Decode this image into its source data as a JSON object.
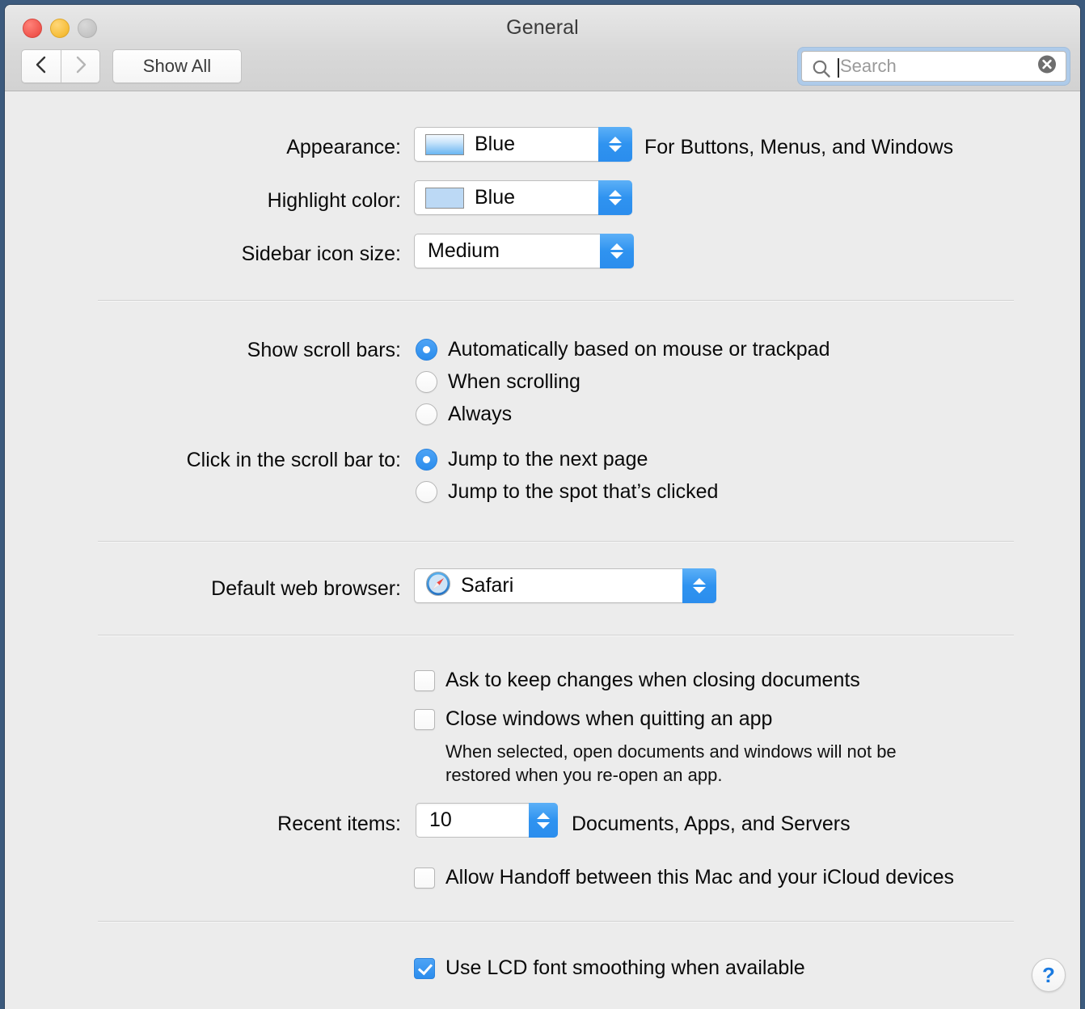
{
  "window": {
    "title": "General",
    "traffic_lights": [
      "close",
      "minimize",
      "zoom"
    ]
  },
  "toolbar": {
    "back_label": "Back",
    "forward_label": "Forward",
    "show_all_label": "Show All",
    "search": {
      "placeholder": "Search",
      "value": "",
      "icon": "search-icon",
      "clear_icon": "clear-icon"
    }
  },
  "settings": {
    "appearance": {
      "label": "Appearance:",
      "value": "Blue",
      "swatch_color": "#6ab6f2",
      "note": "For Buttons, Menus, and Windows"
    },
    "highlight_color": {
      "label": "Highlight color:",
      "value": "Blue",
      "swatch_color": "#bcd9f5"
    },
    "sidebar_icon_size": {
      "label": "Sidebar icon size:",
      "value": "Medium"
    },
    "show_scroll_bars": {
      "label": "Show scroll bars:",
      "options": [
        {
          "label": "Automatically based on mouse or trackpad",
          "selected": true
        },
        {
          "label": "When scrolling",
          "selected": false
        },
        {
          "label": "Always",
          "selected": false
        }
      ]
    },
    "click_scroll_bar": {
      "label": "Click in the scroll bar to:",
      "options": [
        {
          "label": "Jump to the next page",
          "selected": true
        },
        {
          "label": "Jump to the spot that’s clicked",
          "selected": false
        }
      ]
    },
    "default_web_browser": {
      "label": "Default web browser:",
      "value": "Safari",
      "icon": "safari-icon"
    },
    "checkboxes": [
      {
        "label": "Ask to keep changes when closing documents",
        "checked": false
      },
      {
        "label": "Close windows when quitting an app",
        "checked": false
      }
    ],
    "close_windows_help": "When selected, open documents and windows will not be\nrestored when you re-open an app.",
    "recent_items": {
      "label": "Recent items:",
      "value": "10",
      "note": "Documents, Apps, and Servers"
    },
    "handoff": {
      "label": "Allow Handoff between this Mac and your iCloud devices",
      "checked": false
    },
    "lcd_smoothing": {
      "label": "Use LCD font smoothing when available",
      "checked": true
    }
  },
  "help_button": {
    "glyph": "?",
    "accent": "#1a7ae0"
  }
}
